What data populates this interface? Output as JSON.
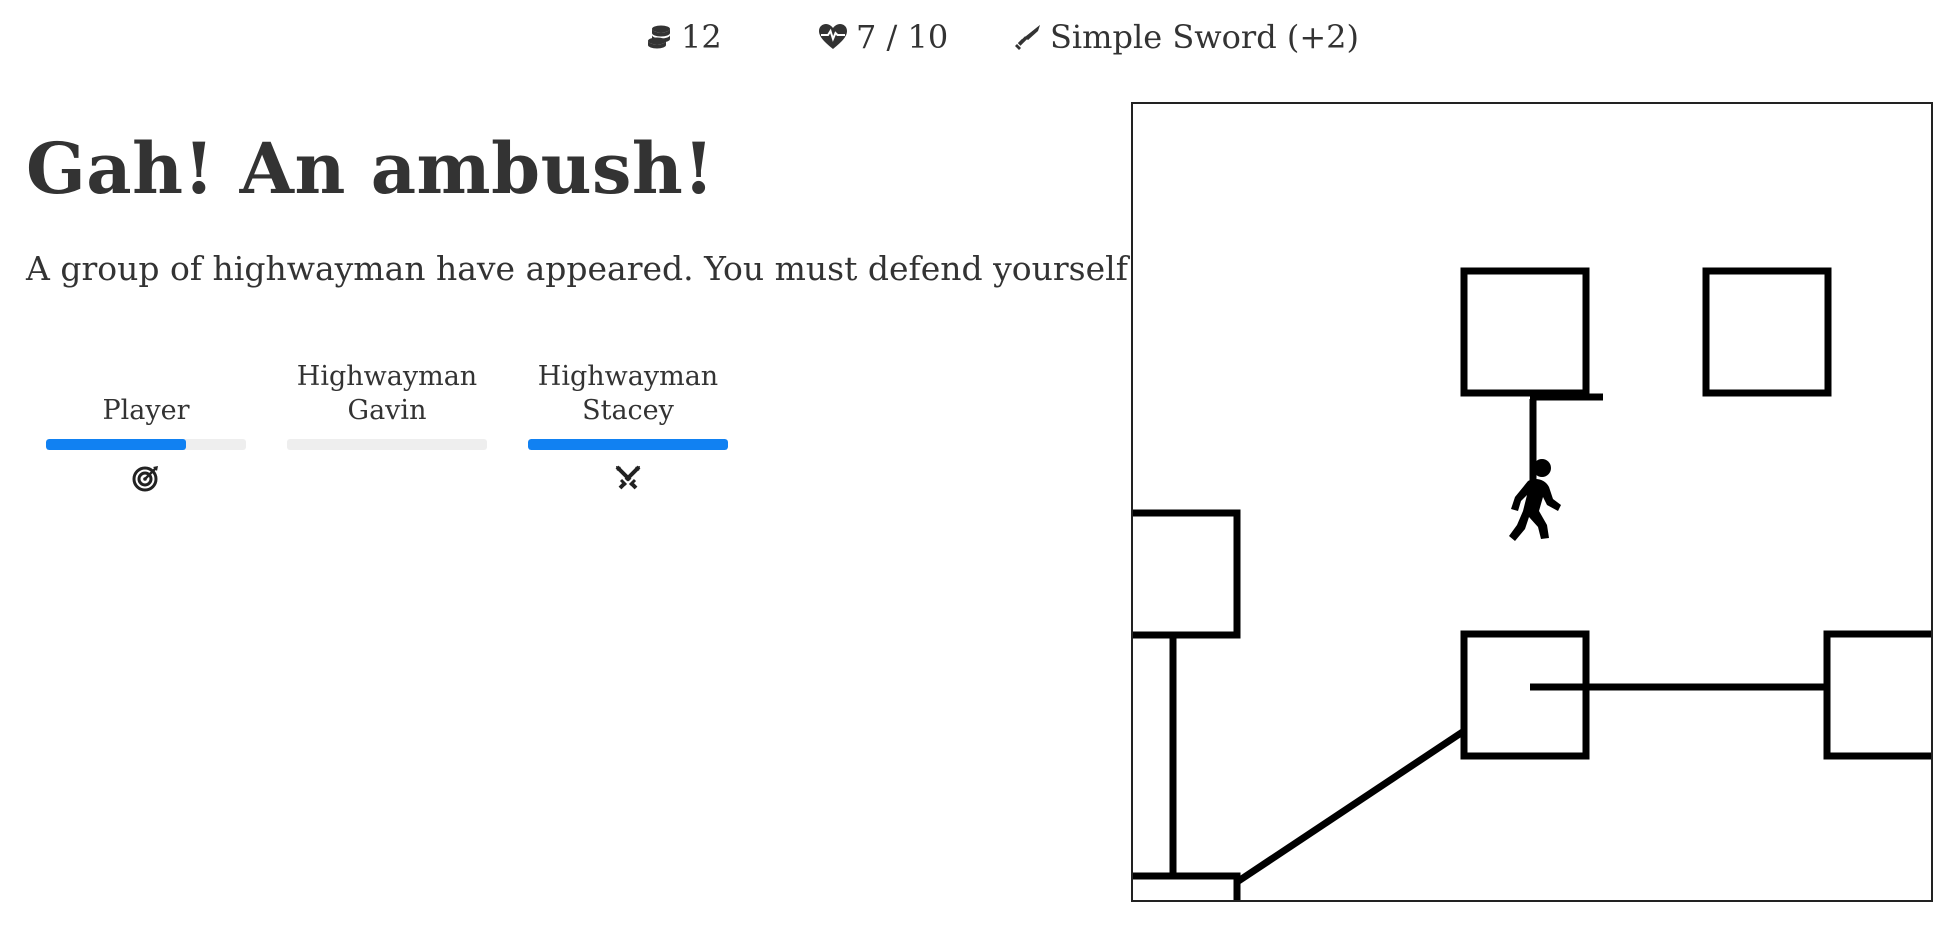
{
  "hud": {
    "gold_icon": "coins-icon",
    "gold": "12",
    "health_icon": "heart-pulse-icon",
    "health": "7 / 10",
    "weapon_icon": "sword-icon",
    "weapon": "Simple Sword (+2)"
  },
  "encounter": {
    "title": "Gah! An ambush!",
    "description": "A group of highwayman have appeared. You must defend yourself!"
  },
  "combatants": [
    {
      "name": "Player",
      "health_fraction": 0.7,
      "status_icon": "target-icon"
    },
    {
      "name": "Highwayman Gavin",
      "health_fraction": 0.0,
      "status_icon": ""
    },
    {
      "name": "Highwayman Stacey",
      "health_fraction": 1.0,
      "status_icon": "crossed-swords-icon"
    }
  ],
  "map": {
    "player_icon": "walking-person-icon"
  },
  "colors": {
    "accent": "#1181f2",
    "text": "#333333",
    "bar_track": "#eeeeee"
  }
}
